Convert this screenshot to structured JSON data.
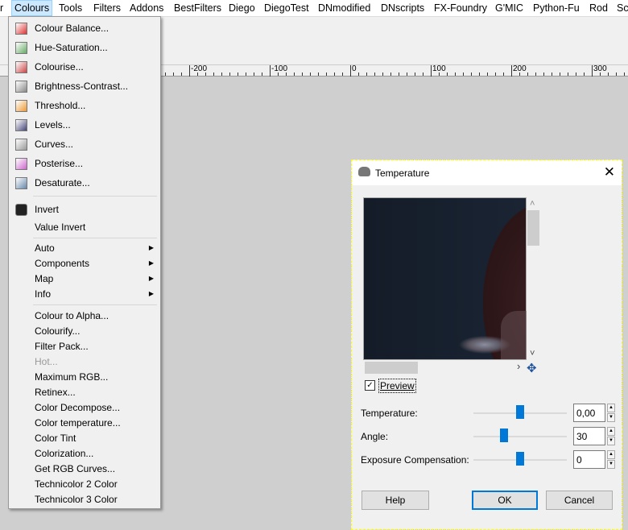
{
  "menubar": {
    "items": [
      "r",
      "Colours",
      "Tools",
      "Filters",
      "Addons",
      "BestFilters",
      "Diego",
      "DiegoTest",
      "DNmodified",
      "DNscripts",
      "FX-Foundry",
      "G'MIC",
      "Python-Fu",
      "Rod",
      "Sc"
    ]
  },
  "ruler": {
    "labels": [
      "-200",
      "-100",
      "0",
      "100",
      "200",
      "300"
    ]
  },
  "colours_menu": {
    "group1": [
      "Colour Balance...",
      "Hue-Saturation...",
      "Colourise...",
      "Brightness-Contrast...",
      "Threshold...",
      "Levels...",
      "Curves...",
      "Posterise...",
      "Desaturate..."
    ],
    "group2": [
      "Invert",
      "Value Invert"
    ],
    "submenus": [
      "Auto",
      "Components",
      "Map",
      "Info"
    ],
    "group3": [
      "Colour to Alpha...",
      "Colourify...",
      "Filter Pack...",
      "Hot...",
      "Maximum RGB...",
      "Retinex...",
      "Color Decompose...",
      "Color temperature...",
      "Color Tint",
      "Colorization...",
      "Get RGB Curves...",
      "Technicolor 2 Color",
      "Technicolor 3 Color"
    ],
    "disabled": [
      "Hot..."
    ]
  },
  "dialog": {
    "title": "Temperature",
    "preview_label": "Preview",
    "preview_checked": true,
    "params": [
      {
        "label": "Temperature:",
        "value": "0,00",
        "slider_fraction": 0.5
      },
      {
        "label": "Angle:",
        "value": "30",
        "slider_fraction": 0.33
      },
      {
        "label": "Exposure Compensation:",
        "value": "0",
        "slider_fraction": 0.5
      }
    ],
    "buttons": {
      "help": "Help",
      "ok": "OK",
      "cancel": "Cancel"
    }
  },
  "colors": {
    "accent": "#0078d7",
    "menu_highlight": "#cce8ff"
  }
}
